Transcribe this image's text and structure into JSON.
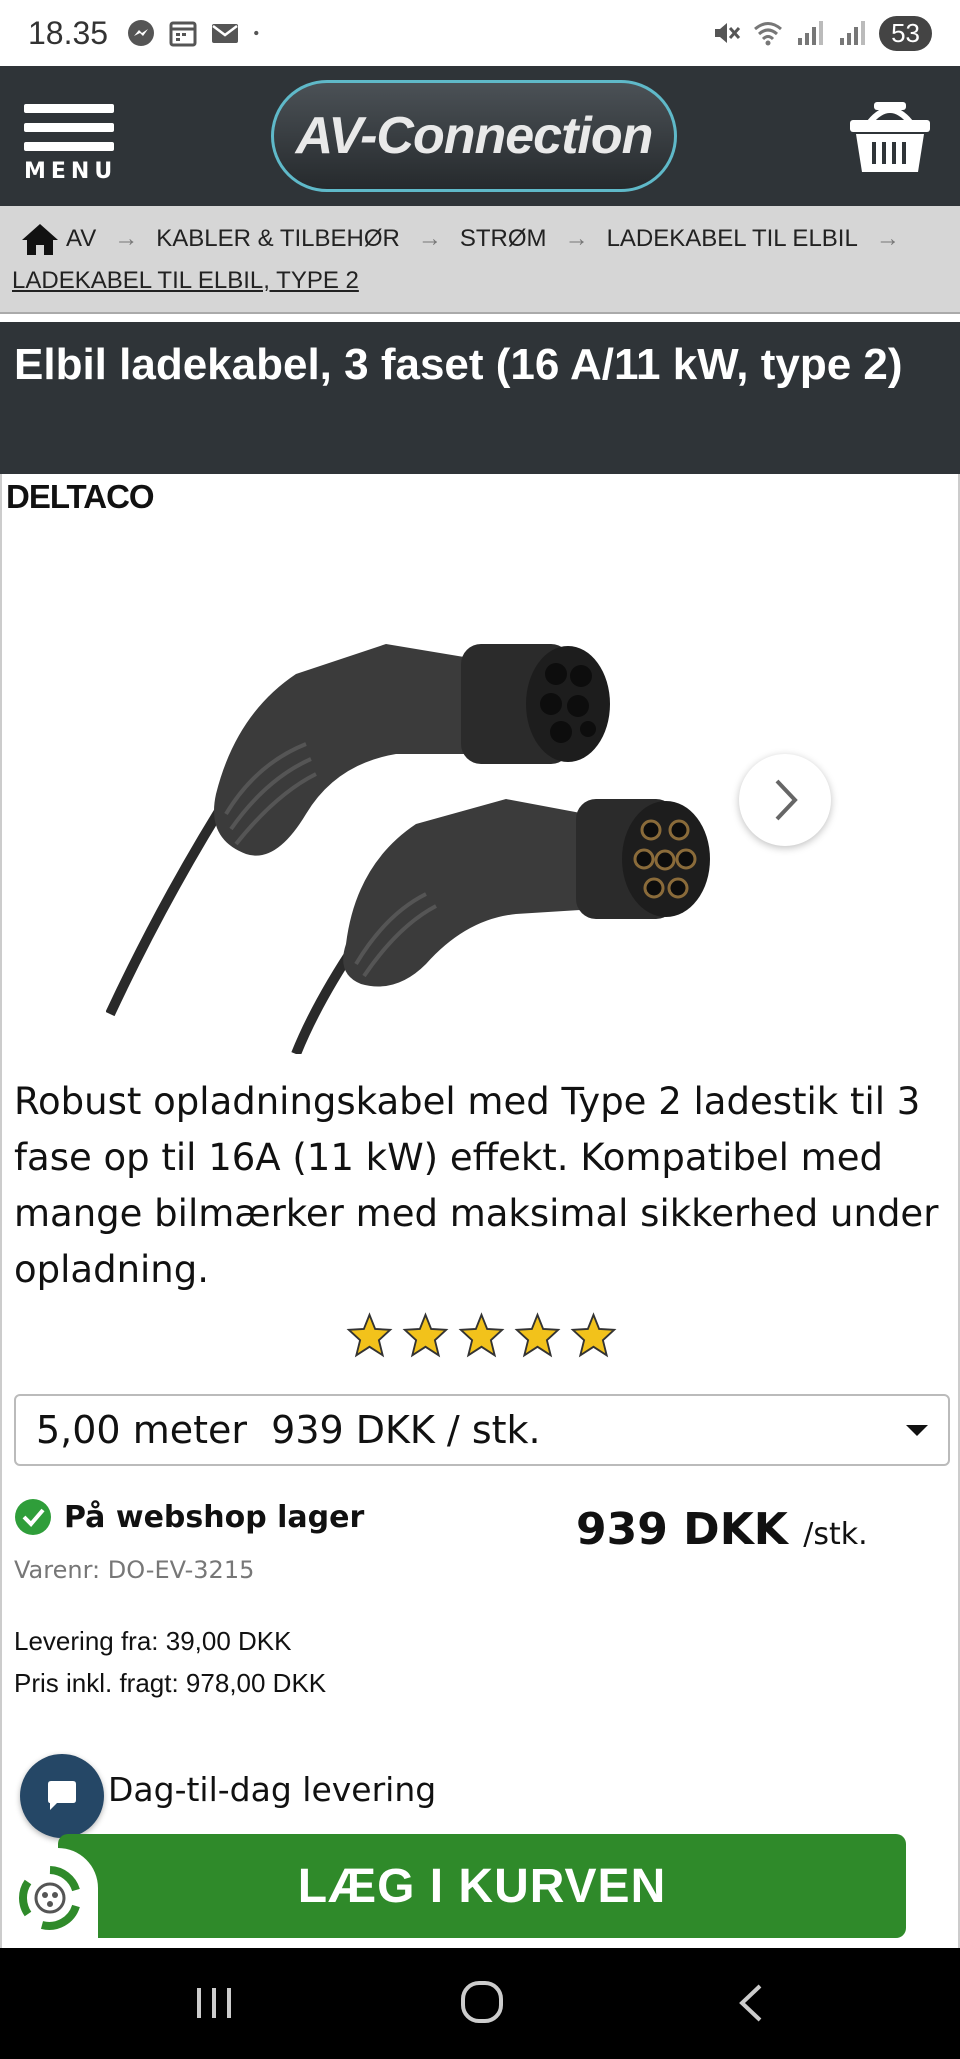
{
  "status_bar": {
    "time": "18.35",
    "battery": "53",
    "icons": [
      "messenger-icon",
      "calendar-icon",
      "mail-icon",
      "dot-icon",
      "mute-icon",
      "wifi-icon",
      "signal-icon",
      "signal-icon"
    ]
  },
  "header": {
    "menu_label": "MENU",
    "logo_text": "AV-Connection",
    "cart_icon": "basket-icon"
  },
  "breadcrumb": {
    "items": [
      "AV",
      "KABLER & TILBEHØR",
      "STRØM",
      "LADEKABEL TIL ELBIL"
    ],
    "arrow": "→",
    "current": "LADEKABEL TIL ELBIL, TYPE 2"
  },
  "product": {
    "title": "Elbil ladekabel, 3 faset (16 A/11 kW, type 2)",
    "brand": "DELTACO",
    "description": "Robust opladningskabel med Type 2 ladestik til 3 fase op til 16A (11 kW) effekt. Kompatibel med mange bilmærker med maksimal sikkerhed under opladning.",
    "rating": 5,
    "rating_max": 5,
    "variant_selected": "5,00 meter  939 DKK / stk.",
    "stock_status": "På webshop lager",
    "sku": "Varenr: DO-EV-3215",
    "price": "939 DKK",
    "price_unit": "/stk.",
    "delivery_from": "Levering fra: 39,00 DKK",
    "price_incl_freight": "Pris inkl. fragt: 978,00 DKK",
    "next_day_delivery": "Dag-til-dag levering",
    "add_to_cart": "LÆG I KURVEN"
  },
  "colors": {
    "header_bg": "#2f3438",
    "breadcrumb_bg": "#d6d6d6",
    "cart_button": "#2f8a2a",
    "chat_button": "#254766",
    "star": "#f2c21b",
    "check": "#2f9e3a"
  }
}
